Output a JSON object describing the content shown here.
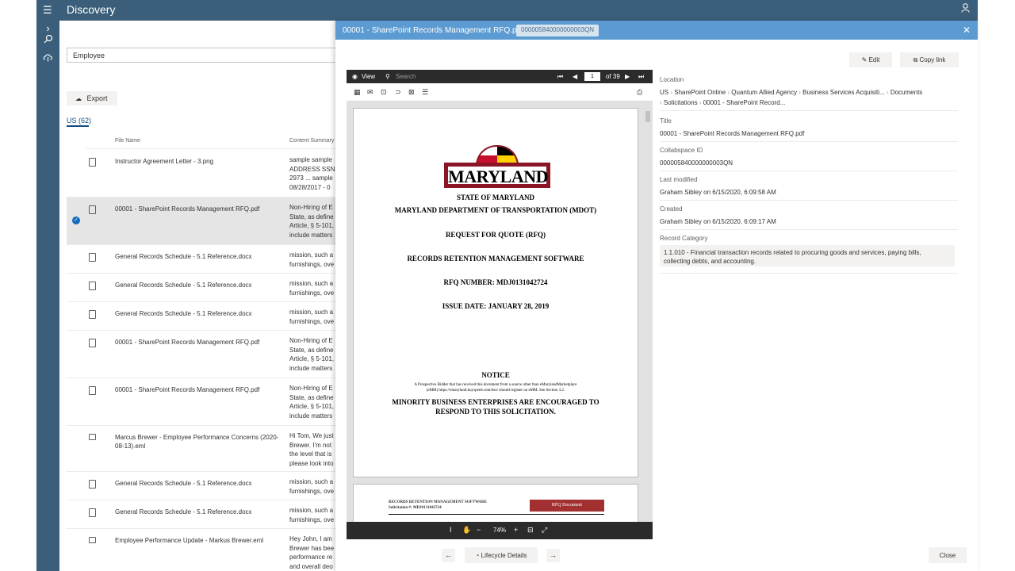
{
  "app": {
    "title": "Discovery",
    "menu_glyph": "☰",
    "user_glyph": "⚲",
    "rail_icons": [
      "chevron-right-icon",
      "search-icon",
      "cloud-icon"
    ]
  },
  "search": {
    "value": "Employee"
  },
  "toolbar": {
    "export_label": "Export"
  },
  "pivot": {
    "label": "US (62)"
  },
  "list": {
    "columns": [
      "File Name",
      "Content Summary"
    ],
    "rows": [
      {
        "name": "Instructor Agreement Letter - 3.png",
        "summary": [
          "sample sample",
          "ADDRESS SSN I",
          "2973 ... sample",
          "08/28/2017 - 0"
        ],
        "icon": "image-file-icon"
      },
      {
        "name": "00001 - SharePoint Records Management RFQ.pdf",
        "summary": [
          "Non-Hiring of E",
          "State, as define",
          "Article, § 5-101,",
          "include matters"
        ],
        "icon": "document-icon"
      },
      {
        "name": "General Records Schedule - 5.1 Reference.docx",
        "summary": [
          "mission, such a",
          "furnishings, ove"
        ],
        "icon": "word-file-icon"
      },
      {
        "name": "General Records Schedule - 5.1 Reference.docx",
        "summary": [
          "mission, such a",
          "furnishings, ove"
        ],
        "icon": "word-file-icon"
      },
      {
        "name": "General Records Schedule - 5.1 Reference.docx",
        "summary": [
          "mission, such a",
          "furnishings, ove"
        ],
        "icon": "word-file-icon"
      },
      {
        "name": "00001 - SharePoint Records Management RFQ.pdf",
        "summary": [
          "Non-Hiring of E",
          "State, as define",
          "Article, § 5-101,",
          "include matters"
        ],
        "icon": "document-icon"
      },
      {
        "name": "00001 - SharePoint Records Management RFQ.pdf",
        "summary": [
          "Non-Hiring of E",
          "State, as define",
          "Article, § 5-101,",
          "include matters"
        ],
        "icon": "document-icon"
      },
      {
        "name": "Marcus Brewer - Employee Performance Concerns (2020-08-13).eml",
        "summary": [
          "Hi Tom, We just",
          "Brewer. I'm not",
          "the level that is",
          "please look into"
        ],
        "icon": "mail-icon"
      },
      {
        "name": "General Records Schedule - 5.1 Reference.docx",
        "summary": [
          "mission, such a",
          "furnishings, ove"
        ],
        "icon": "word-file-icon"
      },
      {
        "name": "General Records Schedule - 5.1 Reference.docx",
        "summary": [
          "mission, such a",
          "furnishings, ove"
        ],
        "icon": "word-file-icon"
      },
      {
        "name": "Employee Performance Update - Markus Brewer.eml",
        "summary": [
          "Hey John,   I am",
          "Brewer has bee",
          "performance re",
          "and overall deo"
        ],
        "icon": "mail-icon"
      }
    ]
  },
  "panel": {
    "title": "00001 - SharePoint Records Management RFQ.pdf",
    "id_badge": "000005840000000003QN",
    "close_glyph": "✕",
    "edit_label": "Edit",
    "copy_link_label": "Copy link",
    "close_label": "Close",
    "lifecycle_label": "Lifecycle Details"
  },
  "viewer": {
    "view_label": "View",
    "search_label": "Search",
    "page_current": "1",
    "page_total": "of 39",
    "zoom": "74%",
    "doc": {
      "logo_text": "MARYLAND",
      "lines": [
        "STATE OF MARYLAND",
        "MARYLAND DEPARTMENT OF TRANSPORTATION (MDOT)",
        "REQUEST FOR QUOTE (RFQ)",
        "RECORDS RETENTION MANAGEMENT SOFTWARE",
        "RFQ NUMBER: MDJ0131042724",
        "ISSUE DATE: JANUARY 28, 2019"
      ],
      "notice_title": "NOTICE",
      "notice_line1": "A Prospective Bidder that has received this document from a source other than eMarylandMarketplace",
      "notice_line2": "(eMM) https://emaryland.buyspeed.com/bso/ should register on eMM. See Section 3.2.",
      "minority_line1": "MINORITY BUSINESS ENTERPRISES ARE ENCOURAGED TO",
      "minority_line2": "RESPOND TO THIS SOLICITATION.",
      "page2_left1": "RECORDS RETENTION MANAGEMENT SOFTWARE",
      "page2_left2": "Solicitation #: MDJ0131042724",
      "page2_right": "RFQ Document"
    }
  },
  "details": {
    "location_label": "Location",
    "location_line1": [
      "US",
      "SharePoint Online",
      "Quantum Allied Agency",
      "Business Services Acquisiti...",
      "Documents"
    ],
    "location_line2": [
      "Solicitations",
      "00001 - SharePoint Record..."
    ],
    "title_label": "Title",
    "title_value": "00001 - SharePoint Records Management RFQ.pdf",
    "collabspace_label": "Collabspace ID",
    "collabspace_value": "000005840000000003QN",
    "last_modified_label": "Last modified",
    "last_modified_value": "Graham Sibley on 6/15/2020, 6:09:58 AM",
    "created_label": "Created",
    "created_value": "Graham Sibley on 6/15/2020, 6:09:17 AM",
    "record_category_label": "Record Category",
    "record_category_line1": "1.1.010 - Financial transaction records related to procuring goods and services, paying bills,",
    "record_category_line2": "collecting debts, and accounting."
  },
  "colors": {
    "shell": "#3b5f7a",
    "panel_header": "#5c9bd1",
    "accent": "#0f4c81"
  }
}
